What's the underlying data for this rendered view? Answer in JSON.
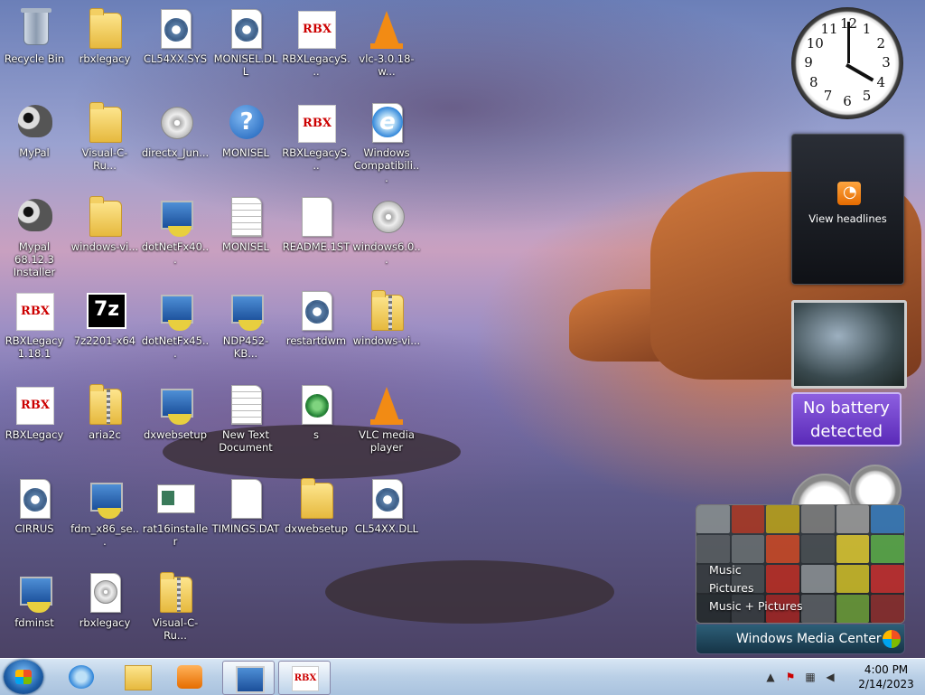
{
  "desktop_icons": [
    {
      "label": "Recycle Bin",
      "icon": "recycle-bin-icon"
    },
    {
      "label": "rbxlegacy",
      "icon": "folder-icon"
    },
    {
      "label": "CL54XX.SYS",
      "icon": "system-file-icon"
    },
    {
      "label": "MONISEL.DLL",
      "icon": "dll-file-icon"
    },
    {
      "label": "RBXLegacyS...",
      "icon": "rbxlegacy-icon"
    },
    {
      "label": "vlc-3.0.18-w...",
      "icon": "vlc-installer-icon"
    },
    {
      "label": "MyPal",
      "icon": "mypal-icon"
    },
    {
      "label": "Visual-C-Ru...",
      "icon": "folder-icon"
    },
    {
      "label": "directx_Jun...",
      "icon": "directx-icon"
    },
    {
      "label": "MONISEL",
      "icon": "help-file-icon"
    },
    {
      "label": "RBXLegacyS...",
      "icon": "rbxlegacy-icon"
    },
    {
      "label": "Windows Compatibili...",
      "icon": "internet-explorer-icon"
    },
    {
      "label": "Mypal 68.12.3 Installer",
      "icon": "mypal-installer-icon"
    },
    {
      "label": "windows-vi...",
      "icon": "folder-icon"
    },
    {
      "label": "dotNetFx40...",
      "icon": "installer-icon"
    },
    {
      "label": "MONISEL",
      "icon": "text-file-icon"
    },
    {
      "label": "README.1ST",
      "icon": "blank-file-icon"
    },
    {
      "label": "windows6.0...",
      "icon": "update-package-icon"
    },
    {
      "label": "RBXLegacy 1.18.1",
      "icon": "rbxlegacy-icon"
    },
    {
      "label": "7z2201-x64",
      "icon": "sevenzip-icon"
    },
    {
      "label": "dotNetFx45...",
      "icon": "installer-icon"
    },
    {
      "label": "NDP452-KB...",
      "icon": "installer-icon"
    },
    {
      "label": "restartdwm",
      "icon": "batch-file-icon"
    },
    {
      "label": "windows-vi...",
      "icon": "zip-folder-icon"
    },
    {
      "label": "RBXLegacy",
      "icon": "rbxlegacy-icon"
    },
    {
      "label": "aria2c",
      "icon": "zip-folder-icon"
    },
    {
      "label": "dxwebsetup",
      "icon": "setup-icon"
    },
    {
      "label": "New Text Document",
      "icon": "text-file-icon"
    },
    {
      "label": "s",
      "icon": "registry-file-icon"
    },
    {
      "label": "VLC media player",
      "icon": "vlc-icon"
    },
    {
      "label": "CIRRUS",
      "icon": "system-file-icon"
    },
    {
      "label": "fdm_x86_se...",
      "icon": "installer-icon"
    },
    {
      "label": "rat16installer",
      "icon": "rat-installer-icon"
    },
    {
      "label": "TIMINGS.DAT",
      "icon": "blank-file-icon"
    },
    {
      "label": "dxwebsetup",
      "icon": "folder-icon"
    },
    {
      "label": "CL54XX.DLL",
      "icon": "dll-file-icon"
    },
    {
      "label": "fdminst",
      "icon": "installer-icon"
    },
    {
      "label": "rbxlegacy",
      "icon": "disc-image-icon"
    },
    {
      "label": "Visual-C-Ru...",
      "icon": "zip-folder-icon"
    }
  ],
  "gadgets": {
    "clock": {
      "numbers": [
        "12",
        "1",
        "2",
        "3",
        "4",
        "5",
        "6",
        "7",
        "8",
        "9",
        "10",
        "11"
      ],
      "hour": 4,
      "minute": 0
    },
    "feeds": {
      "label": "View headlines"
    },
    "battery": {
      "line1": "No battery",
      "line2": "detected"
    },
    "media_center": {
      "menu": [
        "Music",
        "Pictures",
        "Music + Pictures"
      ],
      "brand": "Windows Media Center"
    }
  },
  "taskbar": {
    "pinned": [
      "internet-explorer-icon",
      "windows-explorer-icon",
      "media-player-icon",
      "remote-desktop-icon",
      "rbxlegacy-icon"
    ],
    "time": "4:00 PM",
    "date": "2/14/2023"
  },
  "colors": {
    "accent": "#1e5fa8",
    "battery": "#6b3ac8"
  }
}
